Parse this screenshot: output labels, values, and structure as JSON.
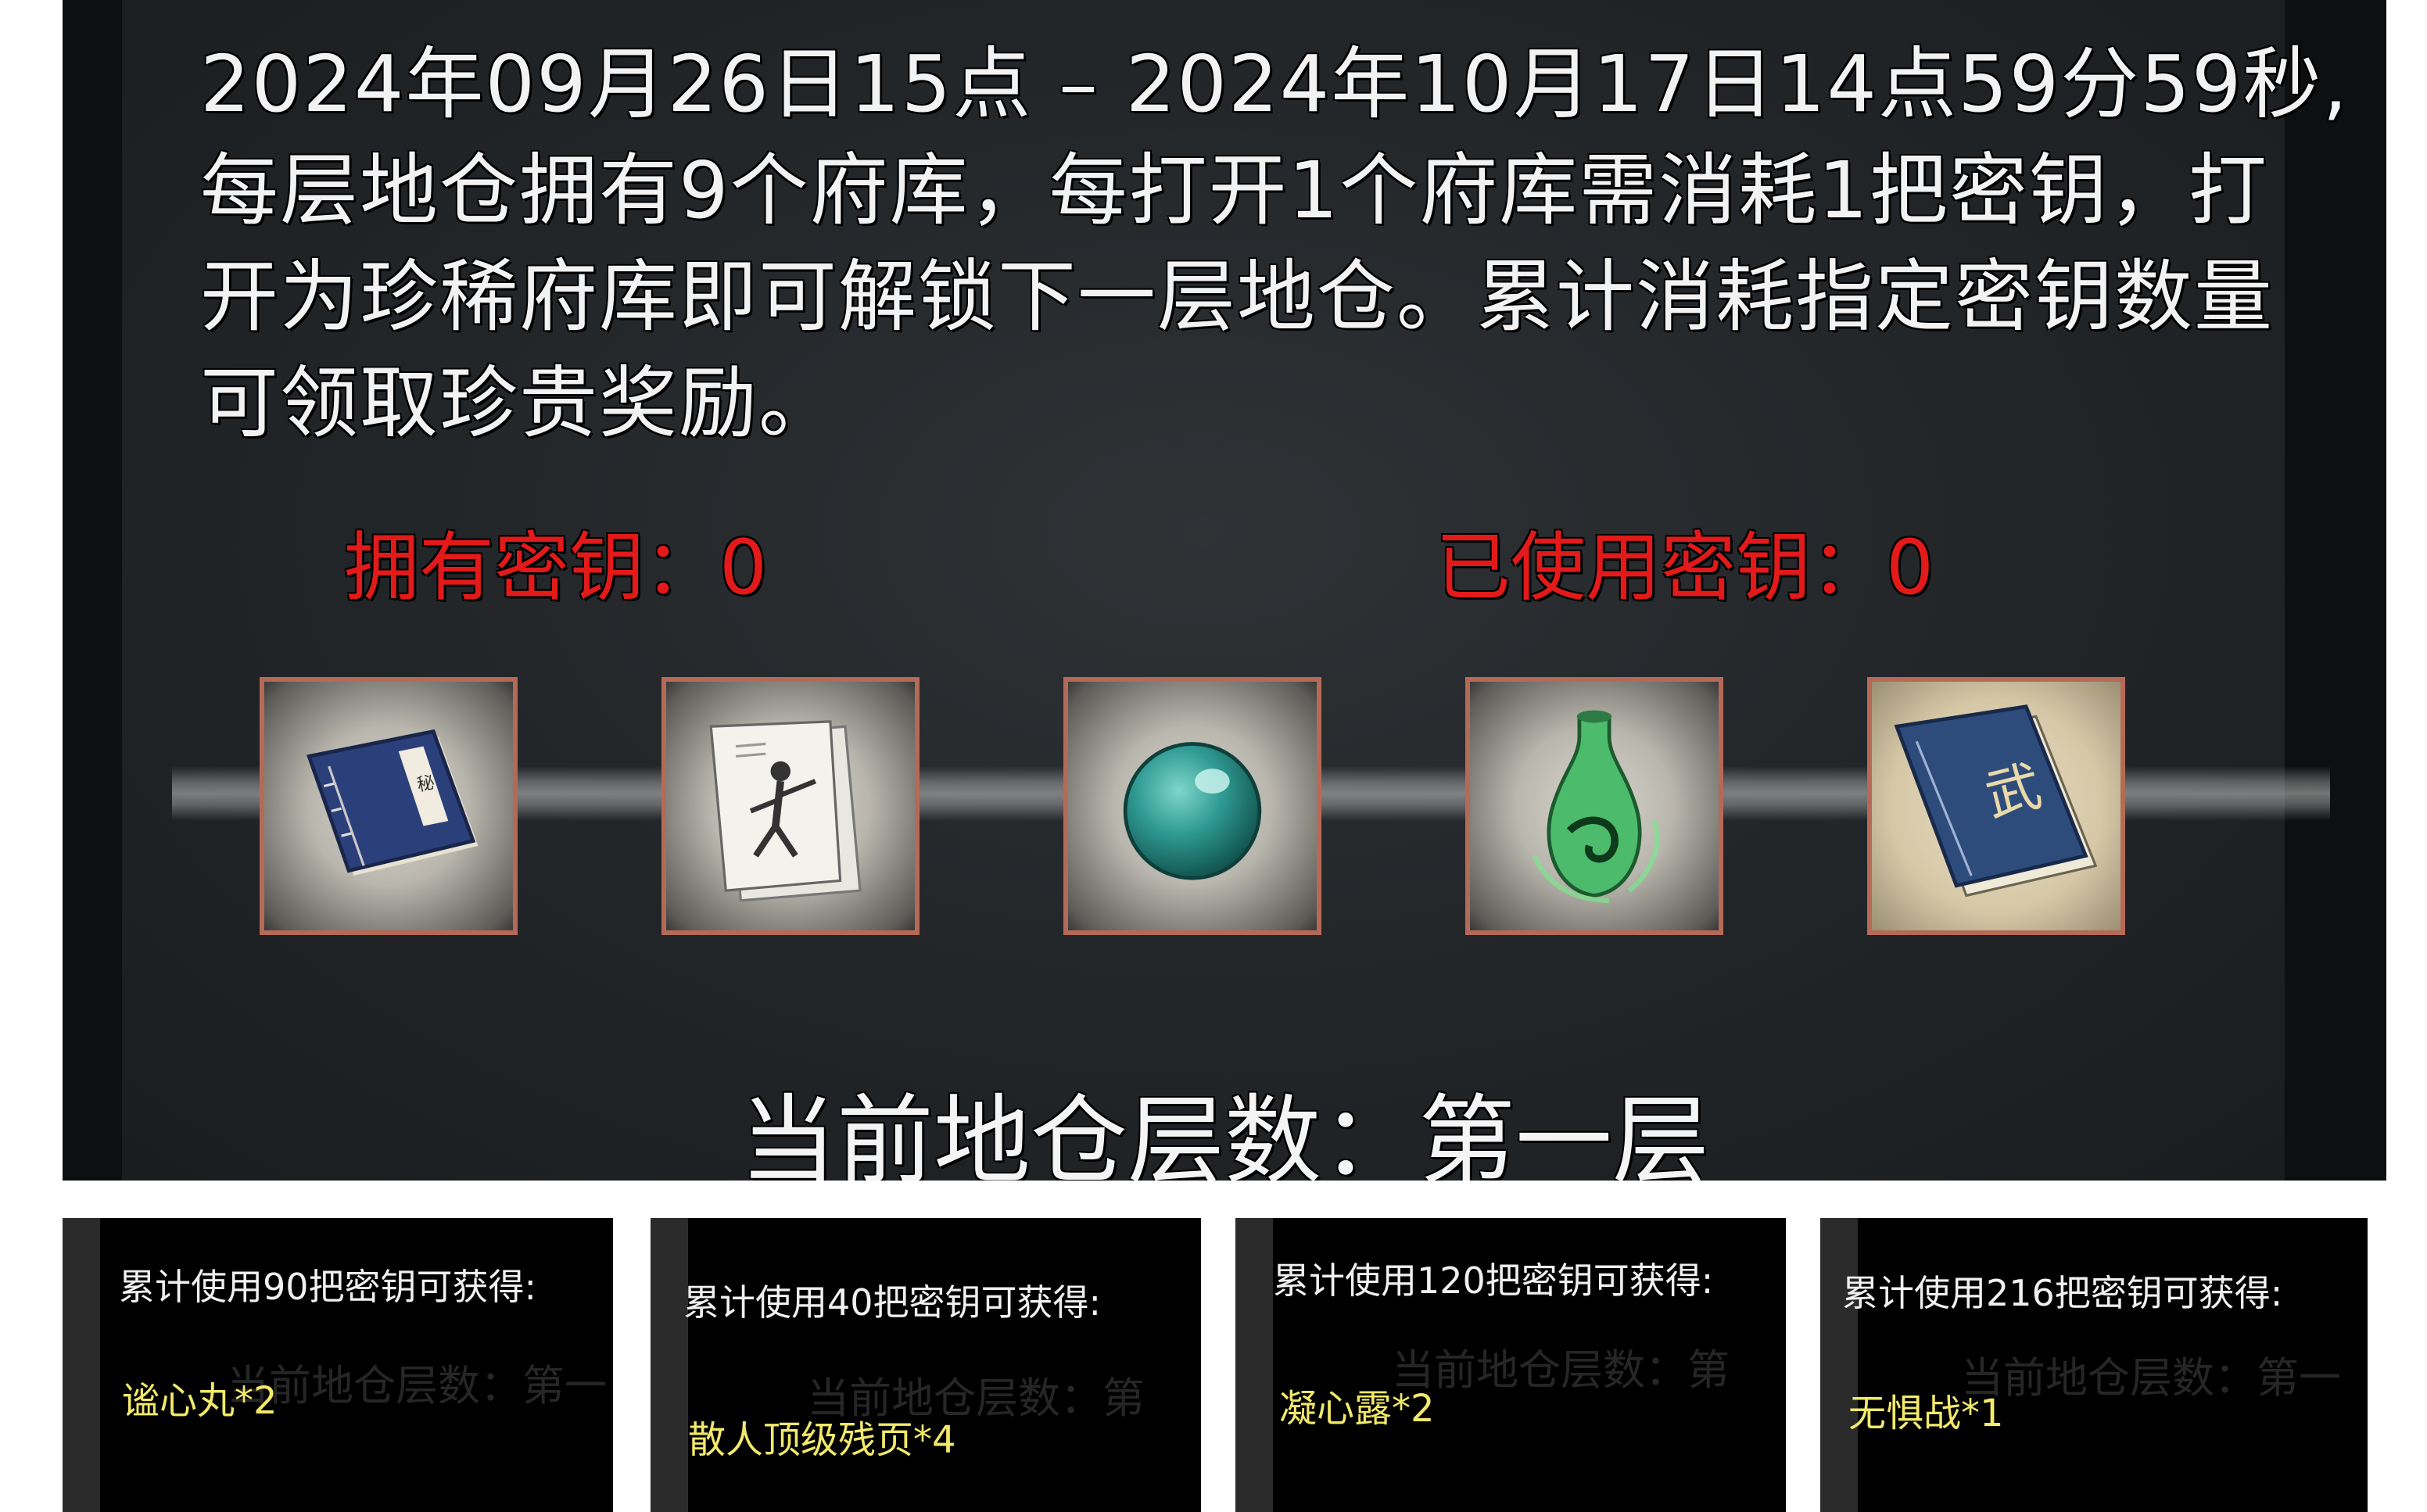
{
  "event": {
    "description_lines": [
      "2024年09月26日15点 – 2024年10月17日14点59分59秒,",
      "每层地仓拥有9个府库，每打开1个府库需消耗1把密钥，打",
      "开为珍稀府库即可解锁下一层地仓。累计消耗指定密钥数量",
      "可领取珍贵奖励。"
    ],
    "keys_owned_label": "拥有密钥：",
    "keys_owned_value": "0",
    "keys_used_label": "已使用密钥：",
    "keys_used_value": "0",
    "current_floor_label": "当前地仓层数：",
    "current_floor_value": "第一层"
  },
  "reward_slots": [
    {
      "icon": "blue-book-icon"
    },
    {
      "icon": "martial-pages-icon"
    },
    {
      "icon": "jade-orb-icon"
    },
    {
      "icon": "green-potion-vase-icon"
    },
    {
      "icon": "wu-manual-icon"
    }
  ],
  "milestones": [
    {
      "title": "累计使用90把密钥可获得:",
      "reward": "谧心丸*2",
      "ghost": "当前地仓层数：第一"
    },
    {
      "title": "累计使用40把密钥可获得:",
      "reward": "散人顶级残页*4",
      "ghost": "当前地仓层数：第"
    },
    {
      "title": "累计使用120把密钥可获得:",
      "reward": "凝心露*2",
      "ghost": "当前地仓层数：第"
    },
    {
      "title": "累计使用216把密钥可获得:",
      "reward": "无惧战*1",
      "ghost": "当前地仓层数：第一"
    }
  ],
  "colors": {
    "key_text": "#e21a1a",
    "reward_text": "#f2e96a",
    "slot_border": "#b56a58"
  }
}
